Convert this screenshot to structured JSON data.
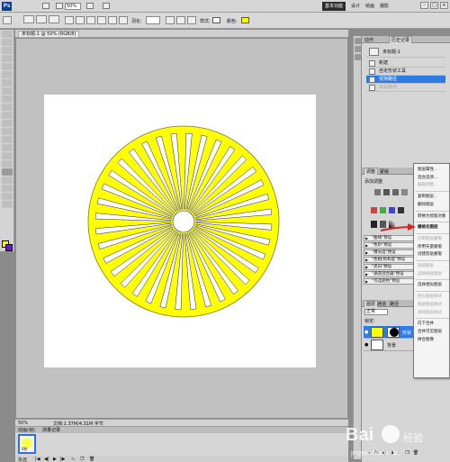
{
  "menubar": {
    "logo": "Ps",
    "zoom": "50%",
    "essentials": "基本功能",
    "workspaces": [
      "设计",
      "绘画",
      "摄影"
    ],
    "menus": [
      "文件(F)",
      "编辑(E)",
      "图像(I)",
      "图层(L)",
      "选择(S)",
      "滤镜(T)",
      "分析(A)",
      "3D(D)",
      "视图(V)",
      "窗口(W)",
      "帮助(H)"
    ]
  },
  "options": {
    "feather_label": "羽化:",
    "feather_value": "0像素",
    "style_label": "样式:",
    "color_label": "颜色:",
    "accent": "#ffff00"
  },
  "document": {
    "tab_title": "未标题-1 @ 50% (RGB/8)",
    "status_zoom": "50%",
    "status_doc": "文档:1.37M/4.31M 字节"
  },
  "chart_data": {
    "type": "sunburst-rays",
    "ray_count": 36,
    "fill": "#ffff00",
    "stroke": "#1f1f9a",
    "bg": "#ffffff"
  },
  "history": {
    "tabs": [
      "历史记录",
      "动作"
    ],
    "snapshot": "未标题-1",
    "items": [
      {
        "label": "新建",
        "state": "normal"
      },
      {
        "label": "自定形状工具",
        "state": "normal"
      },
      {
        "label": "变换路径",
        "state": "selected"
      },
      {
        "label": "填充路径",
        "state": "dim"
      }
    ]
  },
  "adjust": {
    "tabs": [
      "调整",
      "蒙版"
    ],
    "title": "添加调整"
  },
  "actions": [
    "\"曲线\"预设",
    "\"色阶\"预设",
    "\"曝光度\"预设",
    "\"色相/饱和度\"预设",
    "\"黑白\"预设",
    "\"通道混合器\"预设",
    "\"可选颜色\"预设"
  ],
  "contextmenu": {
    "items": [
      {
        "label": "图层属性...",
        "state": "normal"
      },
      {
        "label": "混合选项...",
        "state": "normal"
      },
      {
        "label": "编辑调整...",
        "state": "disabled"
      },
      {
        "sep": true
      },
      {
        "label": "复制图层...",
        "state": "normal"
      },
      {
        "label": "删除图层",
        "state": "normal"
      },
      {
        "sep": true
      },
      {
        "label": "转换为智能对象",
        "state": "normal"
      },
      {
        "sep": true
      },
      {
        "label": "栅格化图层",
        "state": "highlight"
      },
      {
        "sep": true
      },
      {
        "label": "启用图层蒙版",
        "state": "disabled"
      },
      {
        "label": "停用矢量蒙版",
        "state": "normal"
      },
      {
        "label": "创建剪贴蒙版",
        "state": "normal"
      },
      {
        "sep": true
      },
      {
        "label": "链接图层",
        "state": "disabled"
      },
      {
        "label": "选择链接图层",
        "state": "disabled"
      },
      {
        "sep": true
      },
      {
        "label": "选择相似图层",
        "state": "normal"
      },
      {
        "sep": true
      },
      {
        "label": "拷贝图层样式",
        "state": "disabled"
      },
      {
        "label": "粘贴图层样式",
        "state": "disabled"
      },
      {
        "label": "清除图层样式",
        "state": "disabled"
      },
      {
        "sep": true
      },
      {
        "label": "向下合并",
        "state": "normal"
      },
      {
        "label": "合并可见图层",
        "state": "normal"
      },
      {
        "label": "拼合图像",
        "state": "normal"
      }
    ]
  },
  "layers": {
    "tabs": [
      "图层",
      "通道",
      "路径"
    ],
    "blend_mode": "正常",
    "opacity_label": "不透明度:",
    "opacity": "100%",
    "fill_label": "填充:",
    "fill": "100%",
    "lock_label": "锁定:",
    "rows": [
      {
        "name": "形状 1",
        "selected": true
      },
      {
        "name": "背景",
        "selected": false
      }
    ]
  },
  "animation": {
    "tabs": [
      "动画(帧)",
      "测量记录"
    ],
    "frame_time": "0秒",
    "loop": "永远"
  },
  "watermark": {
    "brand": "Bai",
    "brand2": "经验",
    "url": "jingyan.baidu.com"
  }
}
